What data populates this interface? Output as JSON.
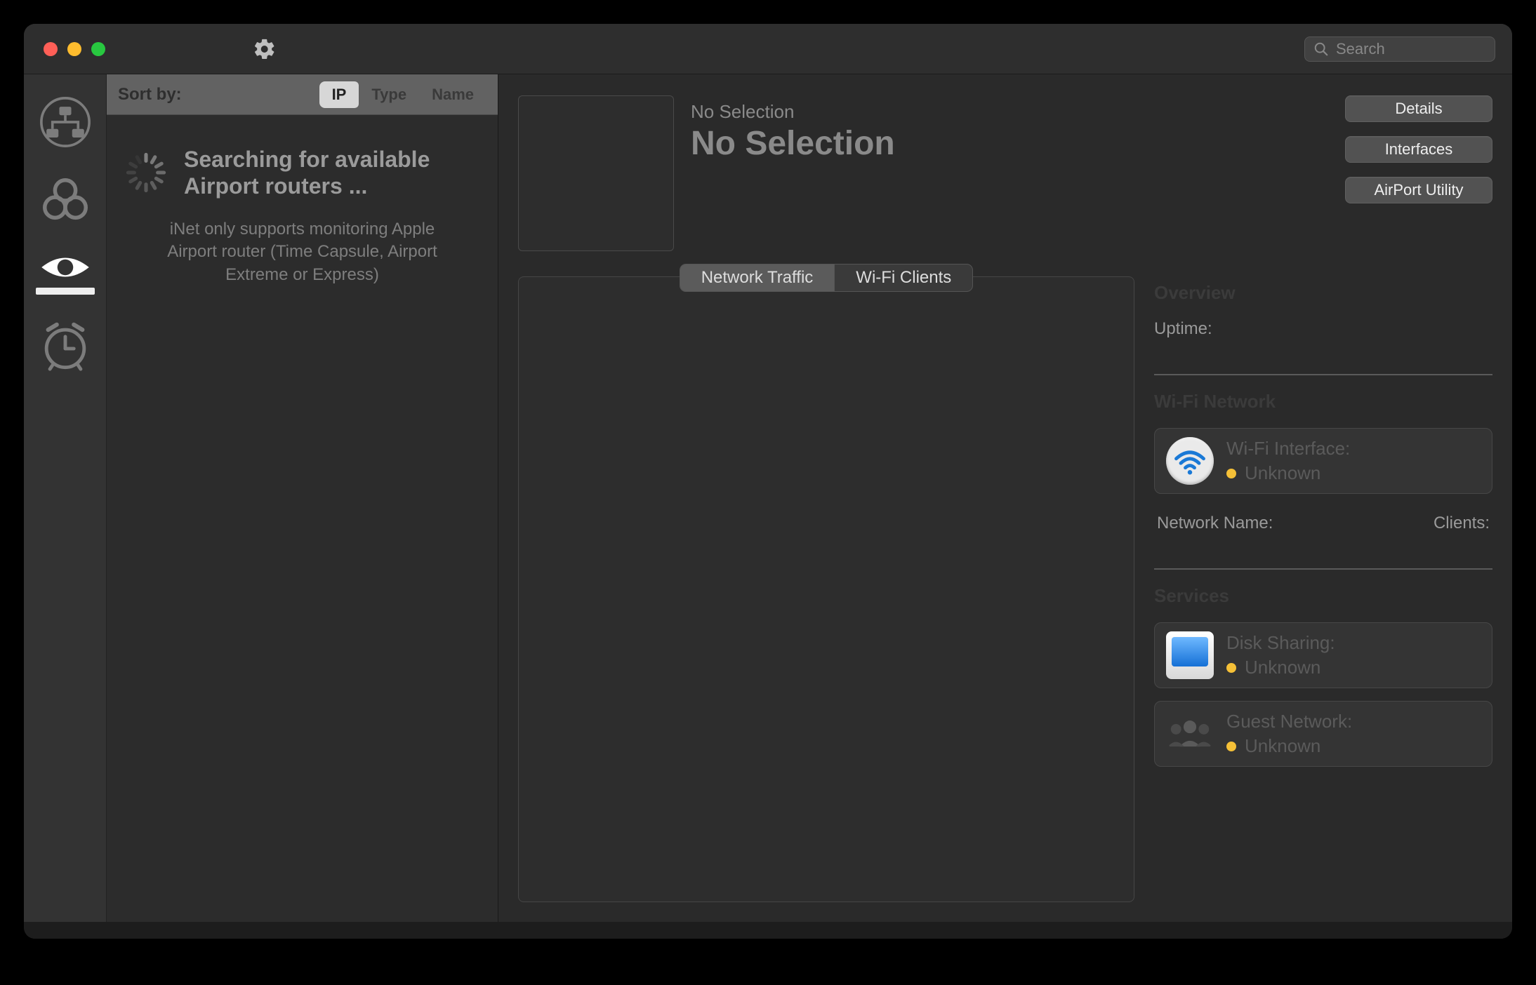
{
  "search": {
    "placeholder": "Search"
  },
  "sort": {
    "label": "Sort by:",
    "options": {
      "ip": "IP",
      "type": "Type",
      "name": "Name"
    },
    "active": "ip"
  },
  "searching": {
    "title": "Searching for available Airport routers ...",
    "subtitle": "iNet only supports monitoring Apple Airport router (Time Capsule, Airport Extreme or Express)"
  },
  "detail": {
    "mini_title": "No Selection",
    "big_title": "No Selection",
    "buttons": {
      "details": "Details",
      "interfaces": "Interfaces",
      "airport_utility": "AirPort Utility"
    }
  },
  "tabs": {
    "network_traffic": "Network Traffic",
    "wifi_clients": "Wi-Fi Clients",
    "active": "network_traffic"
  },
  "info": {
    "section_overview": "Overview",
    "uptime_label": "Uptime:",
    "section_network": "Wi-Fi Network",
    "wifi_card": {
      "label": "Wi-Fi Interface:",
      "status": "Unknown"
    },
    "network_name_label": "Network Name:",
    "clients_label": "Clients:",
    "section_services": "Services",
    "disk_card": {
      "label": "Disk Sharing:",
      "status": "Unknown"
    },
    "guest_card": {
      "label": "Guest Network:",
      "status": "Unknown"
    }
  }
}
